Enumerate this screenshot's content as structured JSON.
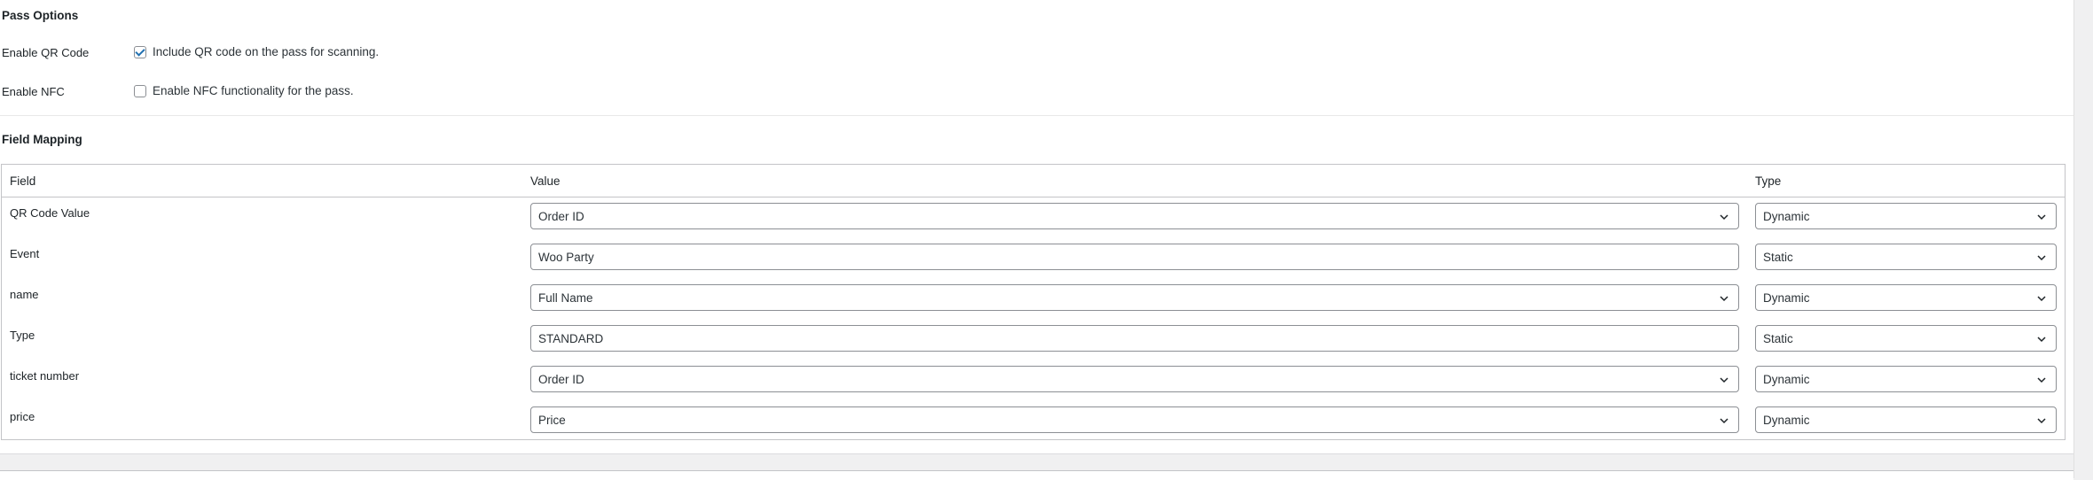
{
  "pass_options": {
    "title": "Pass Options",
    "qr": {
      "label": "Enable QR Code",
      "checked": true,
      "description": "Include QR code on the pass for scanning."
    },
    "nfc": {
      "label": "Enable NFC",
      "checked": false,
      "description": "Enable NFC functionality for the pass."
    }
  },
  "field_mapping": {
    "title": "Field Mapping",
    "columns": [
      "Field",
      "Value",
      "Type"
    ],
    "rows": [
      {
        "field": "QR Code Value",
        "value": "Order ID",
        "value_kind": "select",
        "type": "Dynamic"
      },
      {
        "field": "Event",
        "value": "Woo Party",
        "value_kind": "text",
        "type": "Static"
      },
      {
        "field": "name",
        "value": "Full Name",
        "value_kind": "select",
        "type": "Dynamic"
      },
      {
        "field": "Type",
        "value": "STANDARD",
        "value_kind": "text",
        "type": "Static"
      },
      {
        "field": "ticket number",
        "value": "Order ID",
        "value_kind": "select",
        "type": "Dynamic"
      },
      {
        "field": "price",
        "value": "Price",
        "value_kind": "select",
        "type": "Dynamic"
      }
    ]
  },
  "colors": {
    "accent": "#2271b1",
    "border": "#8c8f94",
    "background": "#f0f0f1"
  },
  "icons": {
    "dropdown": "chevron-down-icon",
    "check": "checkmark-icon"
  }
}
